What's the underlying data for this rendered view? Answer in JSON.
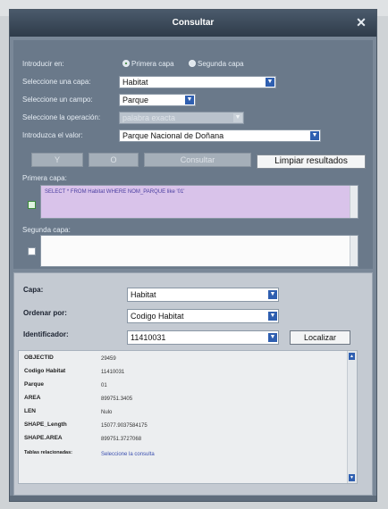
{
  "window": {
    "title": "Consultar",
    "close_glyph": "✕"
  },
  "form": {
    "introducir_en_label": "Introducir en:",
    "radio_primera": "Primera capa",
    "radio_segunda": "Segunda capa",
    "capa_label": "Seleccione una capa:",
    "capa_value": "Habitat",
    "campo_label": "Seleccione un campo:",
    "campo_value": "Parque",
    "operacion_label": "Seleccione la operación:",
    "operacion_value": "palabra exacta",
    "valor_label": "Introduzca el valor:",
    "valor_value": "Parque Nacional de Doñana",
    "btn_y": "Y",
    "btn_o": "O",
    "btn_consultar": "Consultar",
    "btn_limpiar": "Limpiar resultados",
    "primera_capa_label": "Primera capa:",
    "primera_query": "SELECT * FROM Habitat WHERE NOM_PARQUE like '01'",
    "segunda_capa_label": "Segunda capa:",
    "segunda_query": ""
  },
  "results": {
    "capa_label": "Capa:",
    "capa_value": "Habitat",
    "ordenar_label": "Ordenar por:",
    "ordenar_value": "Codigo Habitat",
    "identificador_label": "Identificador:",
    "identificador_value": "11410031",
    "localizar": "Localizar",
    "attributes": [
      {
        "name": "OBJECTID",
        "value": "29459"
      },
      {
        "name": "Codigo Habitat",
        "value": "11410031"
      },
      {
        "name": "Parque",
        "value": "01"
      },
      {
        "name": "AREA",
        "value": "899751.3405"
      },
      {
        "name": "LEN",
        "value": "Nulo"
      },
      {
        "name": "SHAPE_Length",
        "value": "15077.9037584175"
      },
      {
        "name": "SHAPE.AREA",
        "value": "899751.3727068"
      }
    ],
    "partial_row": {
      "name": "Tablas relacionadas:",
      "value": "Seleccione la consulta"
    }
  },
  "icons": {
    "arrow": "▼",
    "up": "▲"
  },
  "colors": {
    "titlebar": "#34414f",
    "panel": "#6a798a",
    "query_bg": "#d9c3ea",
    "accent": "#2f5fb0"
  }
}
